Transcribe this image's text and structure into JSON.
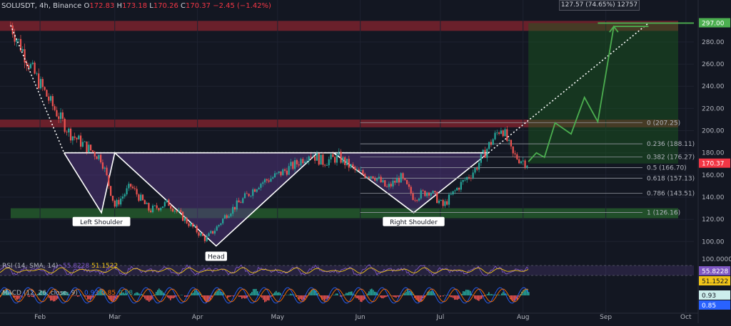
{
  "header": {
    "symbol_label": "SOLUSDT, 4h, Binance",
    "open_label": "O",
    "open_value": "172.83",
    "high_label": "H",
    "high_value": "173.18",
    "low_label": "L",
    "low_value": "170.26",
    "close_label": "C",
    "close_value": "170.37",
    "change": "−2.45 (−1.42%)"
  },
  "measure_box": "127.57 (74.65%) 12757",
  "target_label": "297.00",
  "last_price_label": "170.37",
  "chart_data": [
    {
      "type": "line",
      "title": "SOLUSDT, 4h, Binance",
      "x_axis": {
        "type": "date",
        "tick_labels": [
          "Feb",
          "Mar",
          "Apr",
          "May",
          "Jun",
          "Jul",
          "Aug",
          "Sep",
          "Oct"
        ]
      },
      "y_axis": {
        "tick_labels": [
          "100.00",
          "120.00",
          "140.00",
          "160.00",
          "180.00",
          "200.00",
          "220.00",
          "240.00",
          "260.00",
          "280.00"
        ],
        "ylim": [
          88,
          305
        ]
      },
      "series": [
        {
          "name": "SOLUSDT",
          "x": [
            "2022-01-21",
            "2022-01-29",
            "2022-02-05",
            "2022-02-12",
            "2022-02-18",
            "2022-02-24",
            "2022-03-01",
            "2022-03-07",
            "2022-03-14",
            "2022-03-21",
            "2022-03-28",
            "2022-04-04",
            "2022-04-08",
            "2022-04-12",
            "2022-04-18",
            "2022-04-24",
            "2022-05-01",
            "2022-05-08",
            "2022-05-13",
            "2022-05-18",
            "2022-05-24",
            "2022-05-31",
            "2022-06-06",
            "2022-06-11",
            "2022-06-16",
            "2022-06-21",
            "2022-06-27",
            "2022-07-02",
            "2022-07-08",
            "2022-07-14",
            "2022-07-19",
            "2022-07-24",
            "2022-07-28",
            "2022-08-03"
          ],
          "y": [
            295,
            255,
            225,
            198,
            186,
            175,
            132,
            150,
            128,
            135,
            118,
            102,
            112,
            125,
            138,
            152,
            160,
            170,
            180,
            172,
            176,
            162,
            160,
            148,
            158,
            140,
            146,
            132,
            150,
            165,
            186,
            204,
            178,
            170.37
          ]
        }
      ],
      "projection": {
        "name": "projection",
        "x": [
          "2022-08-03",
          "2022-08-06",
          "2022-08-09",
          "2022-08-13",
          "2022-08-19",
          "2022-08-24",
          "2022-08-29",
          "2022-09-04",
          "2022-09-17"
        ],
        "y": [
          172,
          180,
          176,
          207,
          197,
          230,
          208,
          294,
          294
        ]
      },
      "pattern": {
        "points": [
          {
            "label": "Left Shoulder",
            "x": "2022-02-24",
            "y": 126
          },
          {
            "label": "Head",
            "x": "2022-04-08",
            "y": 96
          },
          {
            "label": "Right Shoulder",
            "x": "2022-06-21",
            "y": 126
          }
        ],
        "neckline": 180
      },
      "fibonacci": [
        {
          "label": "0 (207.25)",
          "level": 0,
          "value": 207.25
        },
        {
          "label": "0.236 (188.11)",
          "level": 0.236,
          "value": 188.11
        },
        {
          "label": "0.382 (176.27)",
          "level": 0.382,
          "value": 176.27
        },
        {
          "label": "0.5 (166.70)",
          "level": 0.5,
          "value": 166.7
        },
        {
          "label": "0.618 (157.13)",
          "level": 0.618,
          "value": 157.13
        },
        {
          "label": "0.786 (143.51)",
          "level": 0.786,
          "value": 143.51
        },
        {
          "label": "1 (126.16)",
          "level": 1,
          "value": 126.16
        }
      ],
      "zones": [
        {
          "color": "#b22833",
          "y1": 290,
          "y2": 299
        },
        {
          "color": "#b22833",
          "y1": 203,
          "y2": 210
        },
        {
          "color": "#2e7d32",
          "y1": 121,
          "y2": 130
        }
      ]
    },
    {
      "type": "line",
      "title": "RSI (14, SMA, 14)",
      "axis_labels": [
        "100.0000",
        "55.8228",
        "51.1522"
      ],
      "series": [
        {
          "name": "RSI",
          "value": 55.8228
        },
        {
          "name": "RSI-based MA",
          "value": 51.1522
        }
      ]
    },
    {
      "type": "bar",
      "title": "MACD (12, 26, close, 9)",
      "axis_labels": [
        "0.93",
        "0.85"
      ],
      "series": [
        {
          "name": "MACD",
          "value": 0.93
        },
        {
          "name": "Signal",
          "value": 0.85
        },
        {
          "name": "Histogram",
          "value": 0.08
        }
      ]
    }
  ],
  "colors": {
    "bg": "#131722",
    "up": "#26a69a",
    "down": "#ef5350",
    "projection": "#4caf50",
    "pattern_fill": "#5b3a8c",
    "price_tag": "#f23645",
    "target": "#4caf50"
  }
}
